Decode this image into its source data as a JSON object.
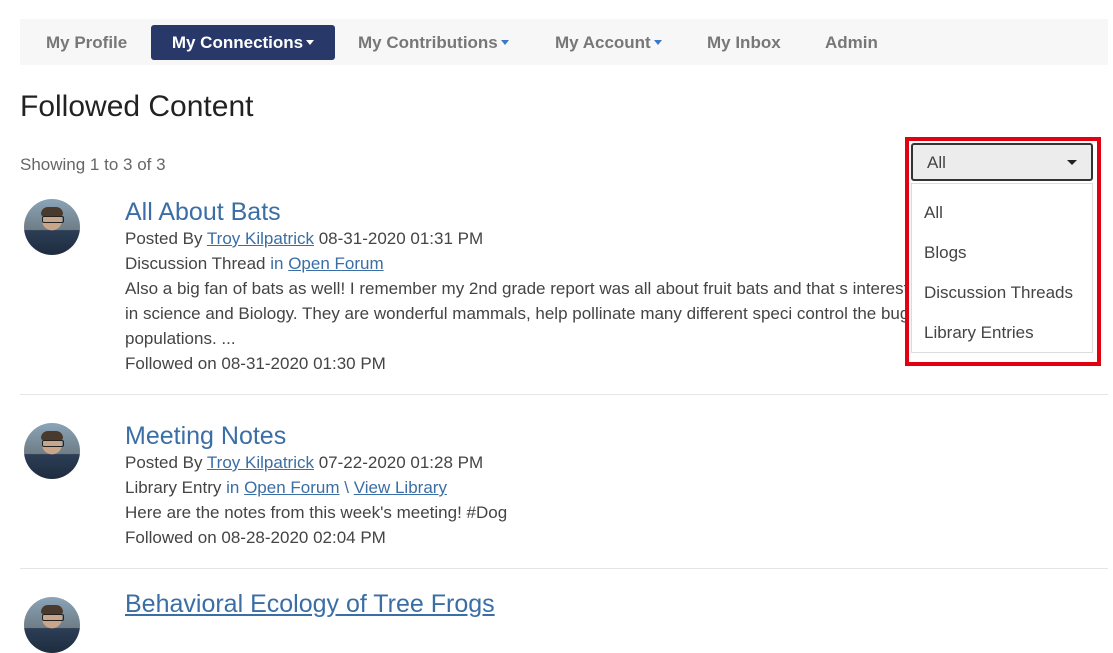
{
  "nav": {
    "items": [
      {
        "label": "My Profile",
        "caret": false
      },
      {
        "label": "My Connections",
        "caret": true,
        "active": true
      },
      {
        "label": "My Contributions",
        "caret": true
      },
      {
        "label": "My Account",
        "caret": true
      },
      {
        "label": "My Inbox",
        "caret": false
      },
      {
        "label": "Admin",
        "caret": false
      }
    ]
  },
  "page": {
    "title": "Followed Content",
    "showing": "Showing 1 to 3 of 3"
  },
  "filter": {
    "selected": "All",
    "options": [
      "All",
      "Blogs",
      "Discussion Threads",
      "Library Entries"
    ]
  },
  "items": [
    {
      "title": "All About Bats",
      "posted_by_label": "Posted By",
      "author": "Troy Kilpatrick",
      "date": "08-31-2020 01:31 PM",
      "type": "Discussion Thread",
      "in_label": "in",
      "community": "Open Forum",
      "excerpt": "Also a big fan of bats as well! I remember my 2nd grade report was all about fruit bats and that s interest in science and Biology. They are wonderful mammals, help pollinate many different speci control the bug populations. ...",
      "followed": "Followed on 08-31-2020 01:30 PM"
    },
    {
      "title": "Meeting Notes",
      "posted_by_label": "Posted By",
      "author": "Troy Kilpatrick",
      "date": "07-22-2020 01:28 PM",
      "type": "Library Entry",
      "in_label": "in",
      "community": "Open Forum",
      "separator": "\\",
      "view_library": "View Library",
      "excerpt": "Here are the notes from this week's meeting! #Dog",
      "followed": "Followed on 08-28-2020 02:04 PM"
    },
    {
      "title": "Behavioral Ecology of Tree Frogs"
    }
  ]
}
